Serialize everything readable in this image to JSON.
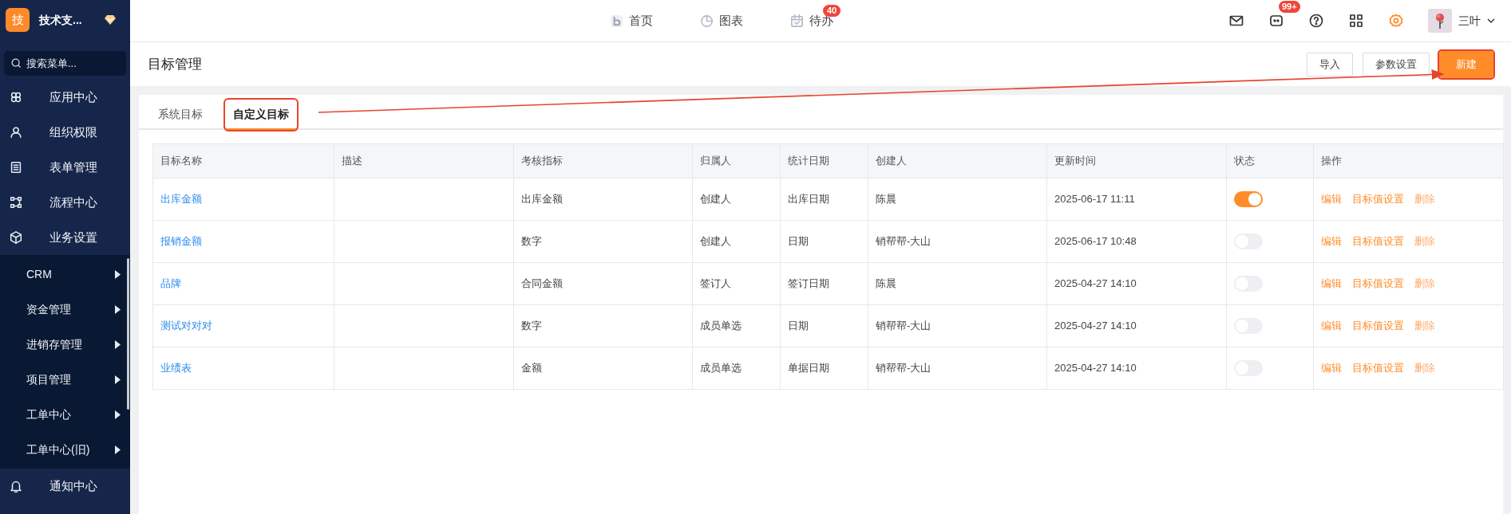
{
  "brand": {
    "logo": "技",
    "name": "技术支..."
  },
  "menu_search": {
    "placeholder": "搜索菜单..."
  },
  "sidebar": {
    "items": [
      {
        "label": "应用中心"
      },
      {
        "label": "组织权限"
      },
      {
        "label": "表单管理"
      },
      {
        "label": "流程中心"
      },
      {
        "label": "业务设置",
        "children": [
          {
            "label": "CRM"
          },
          {
            "label": "资金管理"
          },
          {
            "label": "进销存管理"
          },
          {
            "label": "项目管理"
          },
          {
            "label": "工单中心"
          },
          {
            "label": "工单中心(旧)"
          }
        ]
      },
      {
        "label": "通知中心"
      }
    ]
  },
  "top_nav": [
    {
      "label": "首页"
    },
    {
      "label": "图表"
    },
    {
      "label": "待办",
      "badge": "40"
    }
  ],
  "message_badge": "99+",
  "user": {
    "name": "三叶"
  },
  "page_title": "目标管理",
  "header_buttons": [
    {
      "label": "导入",
      "kind": "default",
      "highlighted": false
    },
    {
      "label": "参数设置",
      "kind": "default",
      "highlighted": false
    },
    {
      "label": "新建",
      "kind": "primary",
      "highlighted": true
    }
  ],
  "tabs": [
    {
      "label": "系统目标",
      "selected": false,
      "highlighted": false
    },
    {
      "label": "自定义目标",
      "selected": true,
      "highlighted": true
    }
  ],
  "table": {
    "columns": [
      "目标名称",
      "描述",
      "考核指标",
      "归属人",
      "统计日期",
      "创建人",
      "更新时间",
      "状态",
      "操作"
    ],
    "rows": [
      {
        "name": "出库金额",
        "metric": "出库金额",
        "owner": "创建人",
        "date_field": "出库日期",
        "creator": "陈晨",
        "updated": "2025-06-17 11:11",
        "on": true,
        "actions": [
          "编辑",
          "目标值设置",
          "删除"
        ]
      },
      {
        "name": "报销金额",
        "metric": "数字",
        "owner": "创建人",
        "date_field": "日期",
        "creator": "销帮帮-大山",
        "updated": "2025-06-17 10:48",
        "on": false,
        "actions": [
          "编辑",
          "目标值设置",
          "删除"
        ]
      },
      {
        "name": "品牌",
        "metric": "合同金额",
        "owner": "签订人",
        "date_field": "签订日期",
        "creator": "陈晨",
        "updated": "2025-04-27 14:10",
        "on": false,
        "actions": [
          "编辑",
          "目标值设置",
          "删除"
        ]
      },
      {
        "name": "测试对对对",
        "metric": "数字",
        "owner": "成员单选",
        "date_field": "日期",
        "creator": "销帮帮-大山",
        "updated": "2025-04-27 14:10",
        "on": false,
        "actions": [
          "编辑",
          "目标值设置",
          "删除"
        ]
      },
      {
        "name": "业绩表",
        "metric": "金额",
        "owner": "成员单选",
        "date_field": "单据日期",
        "creator": "销帮帮-大山",
        "updated": "2025-04-27 14:10",
        "on": false,
        "actions": [
          "编辑",
          "目标值设置",
          "删除"
        ]
      }
    ]
  }
}
